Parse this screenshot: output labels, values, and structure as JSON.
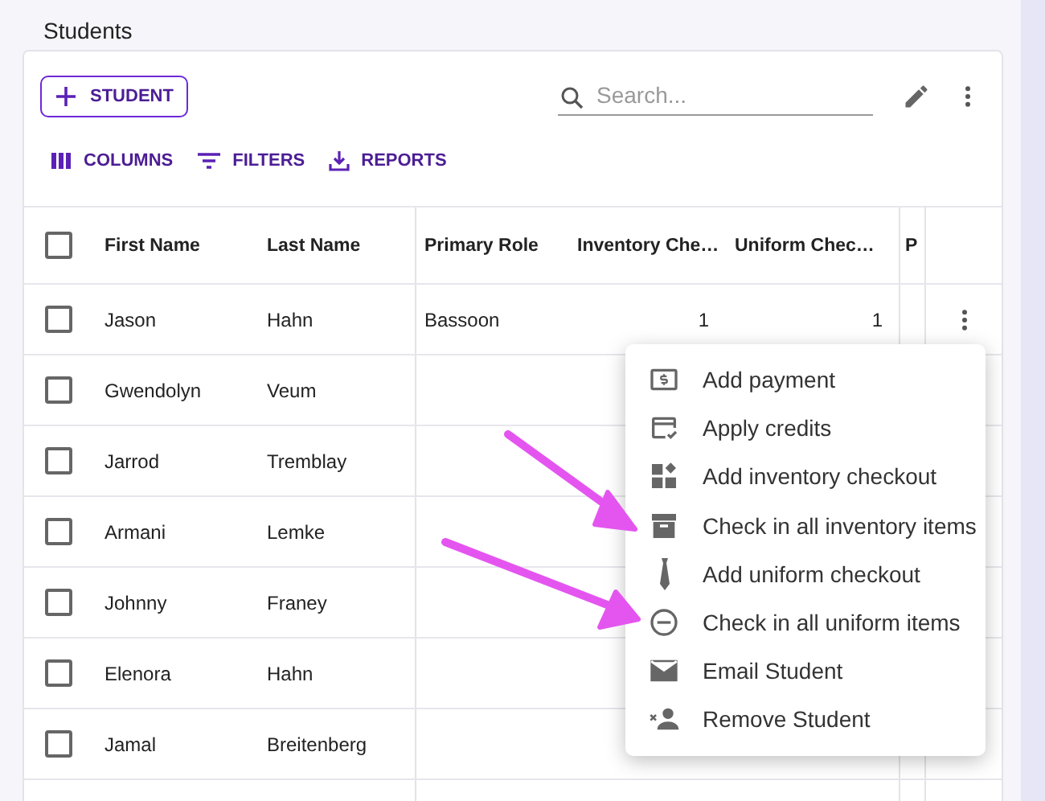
{
  "page": {
    "title": "Students"
  },
  "toolbar": {
    "add_button": "STUDENT",
    "search": {
      "placeholder": "Search..."
    },
    "actions": [
      {
        "label": "COLUMNS"
      },
      {
        "label": "FILTERS"
      },
      {
        "label": "REPORTS"
      }
    ]
  },
  "table": {
    "select_all": {
      "checked": false
    },
    "columns": [
      "First Name",
      "Last Name",
      "Primary Role",
      "Inventory Che…",
      "Uniform Chec…",
      "P"
    ],
    "rows": [
      {
        "checked": false,
        "cells": [
          "Jason",
          "Hahn",
          "Bassoon",
          "1",
          "1",
          ""
        ],
        "has_menu": true
      },
      {
        "checked": false,
        "cells": [
          "Gwendolyn",
          "Veum",
          "",
          "",
          "",
          ""
        ]
      },
      {
        "checked": false,
        "cells": [
          "Jarrod",
          "Tremblay",
          "",
          "",
          "",
          ""
        ]
      },
      {
        "checked": false,
        "cells": [
          "Armani",
          "Lemke",
          "",
          "",
          "",
          ""
        ]
      },
      {
        "checked": false,
        "cells": [
          "Johnny",
          "Franey",
          "",
          "",
          "",
          ""
        ]
      },
      {
        "checked": false,
        "cells": [
          "Elenora",
          "Hahn",
          "",
          "",
          "",
          ""
        ]
      },
      {
        "checked": false,
        "cells": [
          "Jamal",
          "Breitenberg",
          "",
          "",
          "",
          ""
        ]
      }
    ]
  },
  "context_menu": {
    "items": [
      {
        "label": "Add payment"
      },
      {
        "label": "Apply credits"
      },
      {
        "label": "Add inventory checkout"
      },
      {
        "label": "Check in all inventory items"
      },
      {
        "label": "Add uniform checkout"
      },
      {
        "label": "Check in all uniform items"
      },
      {
        "label": "Email Student"
      },
      {
        "label": "Remove Student"
      }
    ]
  }
}
